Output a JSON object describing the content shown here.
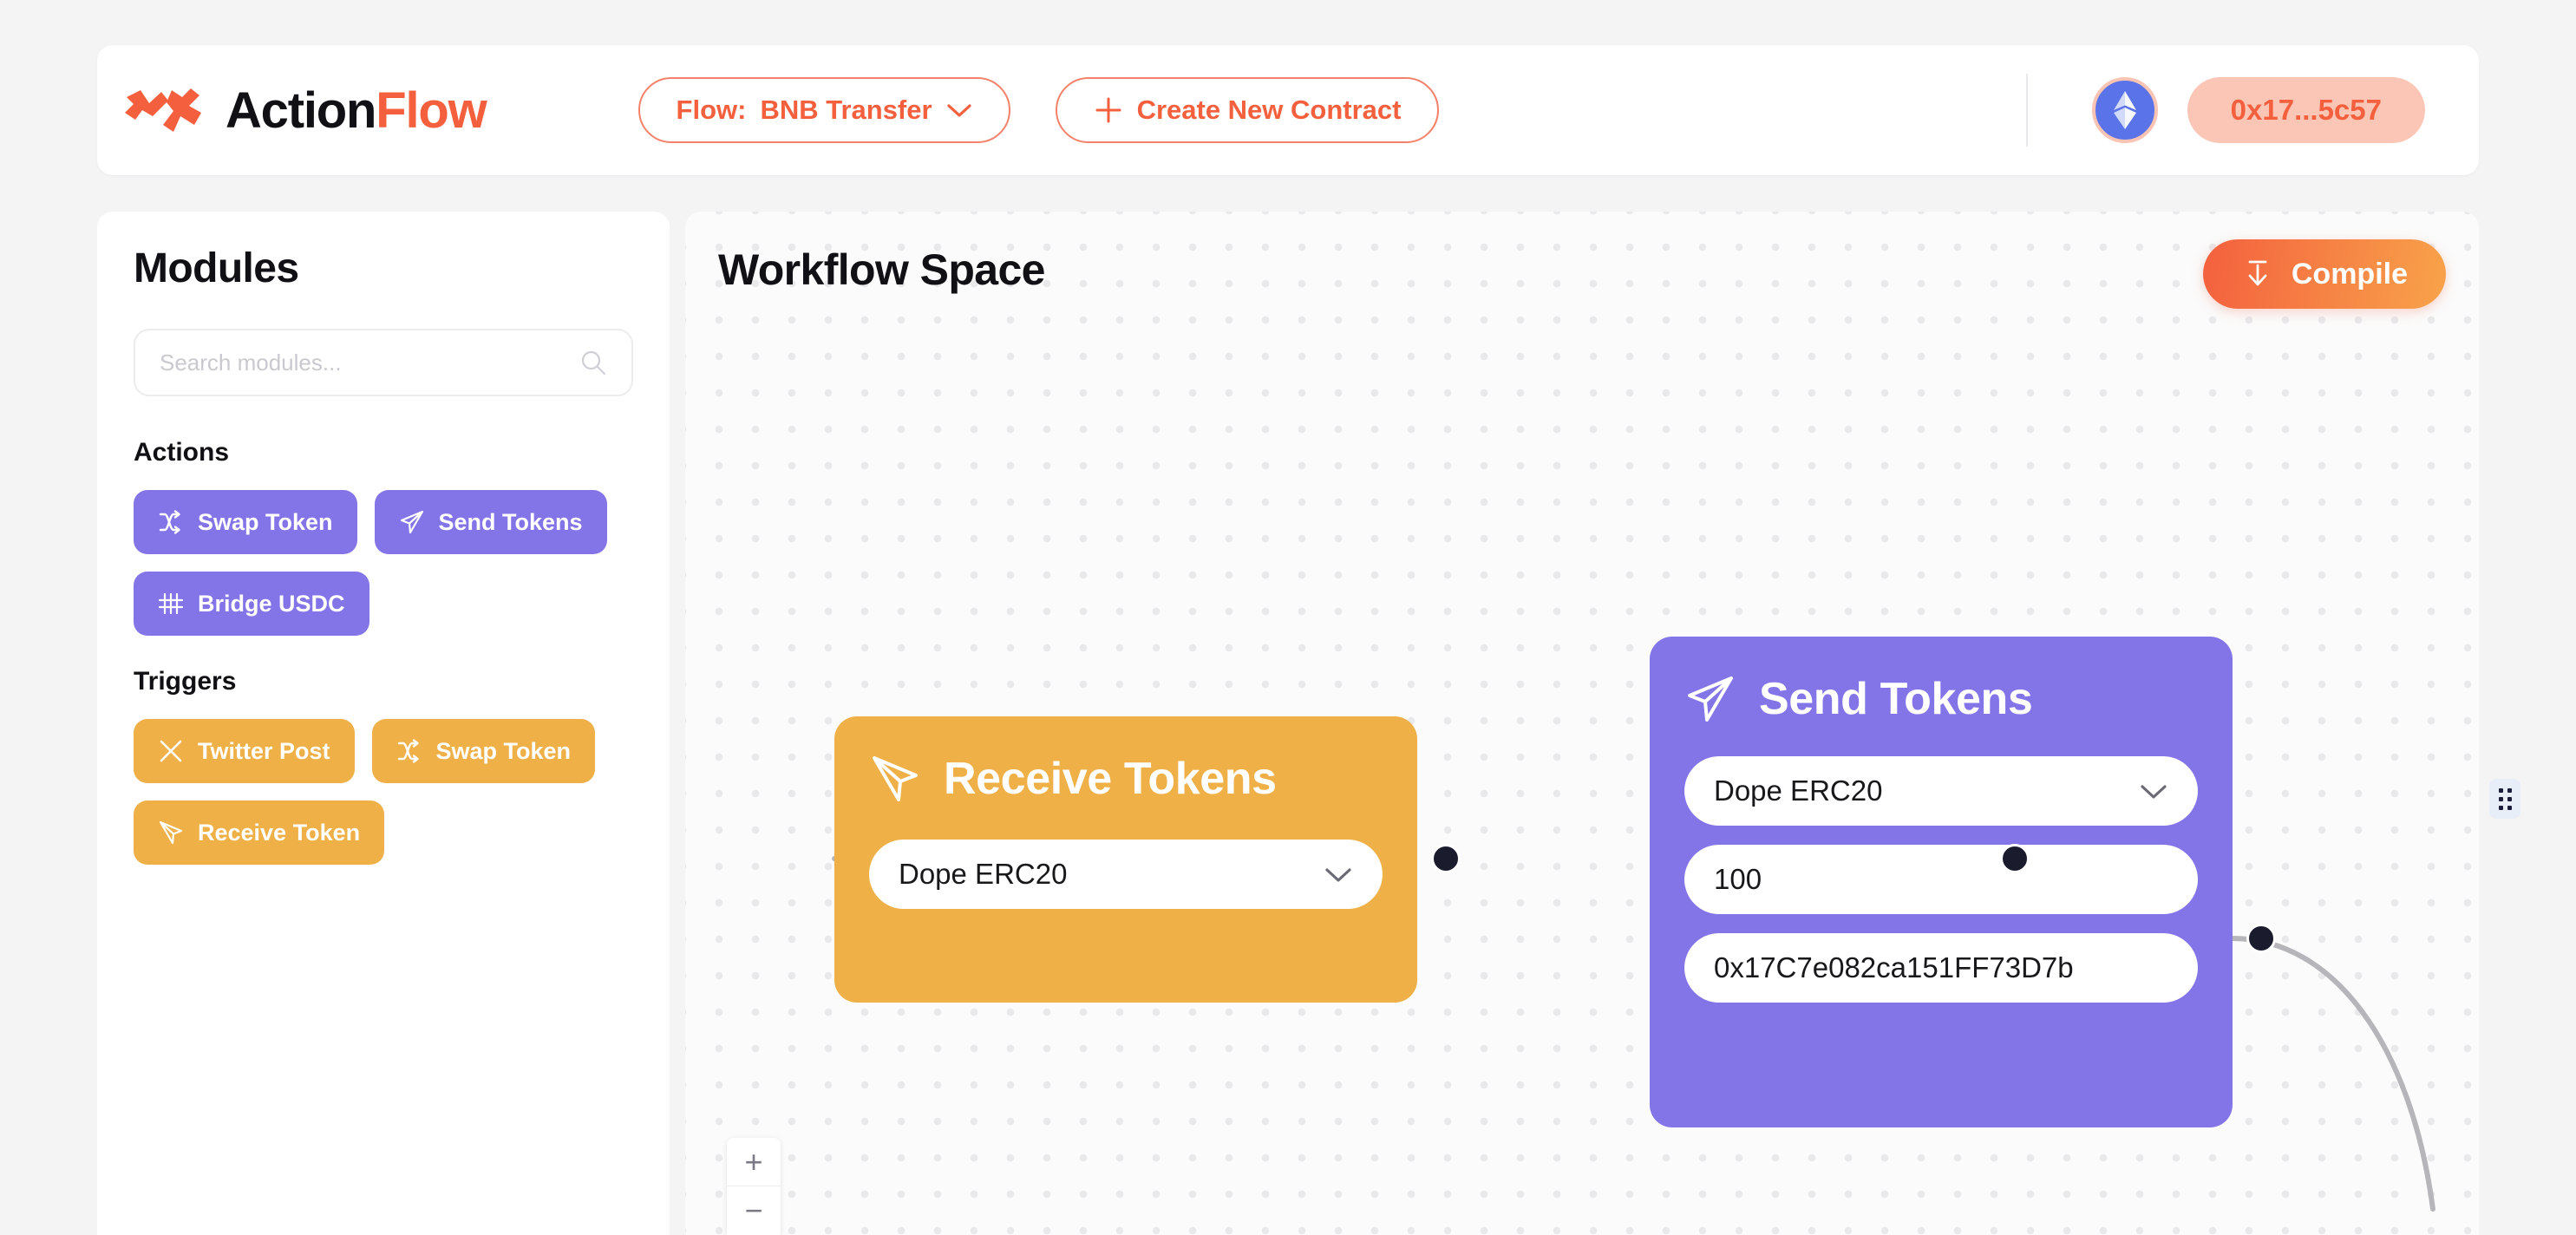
{
  "header": {
    "brand": {
      "name_primary": "Action",
      "name_accent": "Flow",
      "logo_icon": "actionflow-logo-icon"
    },
    "flow_selector": {
      "label": "Flow:",
      "value": "BNB Transfer",
      "chevron_icon": "chevron-down-icon"
    },
    "create_contract": {
      "label": "Create New Contract",
      "plus_icon": "plus-icon"
    },
    "chain_badge": {
      "icon": "ethereum-icon"
    },
    "wallet": {
      "address": "0x17...5c57"
    }
  },
  "sidebar": {
    "title": "Modules",
    "search": {
      "placeholder": "Search modules...",
      "value": "",
      "icon": "search-icon"
    },
    "groups": [
      {
        "title": "Actions",
        "items": [
          {
            "label": "Swap Token",
            "icon": "shuffle-icon",
            "color": "#8374e8"
          },
          {
            "label": "Send Tokens",
            "icon": "paper-plane-icon",
            "color": "#8374e8"
          },
          {
            "label": "Bridge USDC",
            "icon": "bridge-icon",
            "color": "#8374e8"
          }
        ]
      },
      {
        "title": "Triggers",
        "items": [
          {
            "label": "Twitter Post",
            "icon": "x-twitter-icon",
            "color": "#eeb047"
          },
          {
            "label": "Swap Token",
            "icon": "shuffle-icon",
            "color": "#eeb047"
          },
          {
            "label": "Receive Token",
            "icon": "receive-plane-icon",
            "color": "#eeb047"
          }
        ]
      }
    ]
  },
  "canvas": {
    "title": "Workflow Space",
    "compile_button": {
      "label": "Compile",
      "icon": "compile-download-icon"
    },
    "zoom_controls": {
      "zoom_in": "+",
      "zoom_out": "−"
    },
    "nodes": [
      {
        "id": "receive",
        "title": "Receive Tokens",
        "icon": "receive-plane-icon",
        "color": "#eeb047",
        "fields": [
          {
            "type": "select",
            "value": "Dope ERC20",
            "chevron_icon": "chevron-down-icon"
          }
        ]
      },
      {
        "id": "send",
        "title": "Send Tokens",
        "icon": "paper-plane-icon",
        "color": "#8374e8",
        "fields": [
          {
            "type": "select",
            "value": "Dope ERC20",
            "chevron_icon": "chevron-down-icon"
          },
          {
            "type": "text",
            "value": "100"
          },
          {
            "type": "text",
            "value": "0x17C7e082ca151FF73D7b"
          }
        ]
      }
    ]
  },
  "panel_resizer": {
    "icon": "drag-dots-icon"
  },
  "colors": {
    "accent_orange": "#f4603e",
    "node_purple": "#8374e8",
    "node_amber": "#eeb047",
    "page_bg": "#f4f4f5"
  }
}
